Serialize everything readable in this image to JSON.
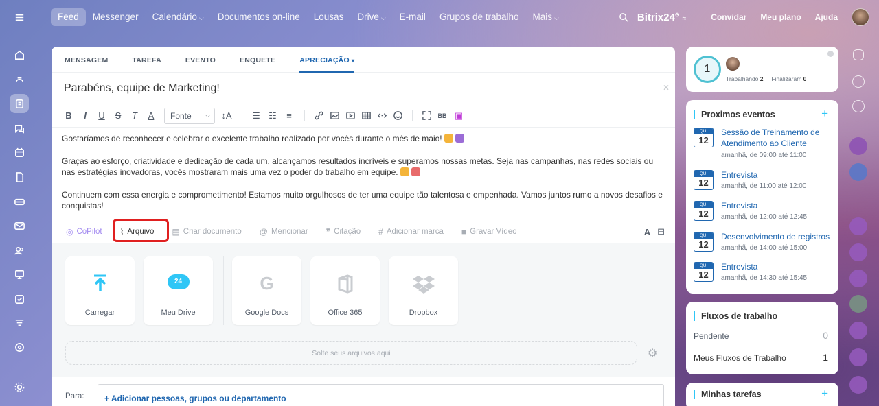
{
  "topnav": {
    "items": [
      "Feed",
      "Messenger",
      "Calendário",
      "Documentos on-line",
      "Lousas",
      "Drive",
      "E-mail",
      "Grupos de trabalho",
      "Mais"
    ],
    "logo": "Bitrix24",
    "invite": "Convidar",
    "plan": "Meu plano",
    "help": "Ajuda"
  },
  "composer": {
    "tabs": [
      "MENSAGEM",
      "TAREFA",
      "EVENTO",
      "ENQUETE",
      "APRECIAÇÃO"
    ],
    "title": "Parabéns, equipe de Marketing!",
    "font_label": "Fonte",
    "paragraphs": [
      "Gostaríamos de reconhecer e celebrar o excelente trabalho realizado por vocês durante o mês de maio!",
      "Graças ao esforço, criatividade e dedicação de cada um, alcançamos resultados incríveis e superamos nossas metas. Seja nas campanhas, nas redes sociais ou nas estratégias inovadoras, vocês mostraram mais uma vez o poder do trabalho em equipe.",
      "Continuem com essa energia e comprometimento! Estamos muito orgulhosos de ter uma equipe tão talentosa e empenhada. Vamos juntos rumo a novos desafios e conquistas!"
    ],
    "actions": [
      "CoPilot",
      "Arquivo",
      "Criar documento",
      "Mencionar",
      "Citação",
      "Adicionar marca",
      "Gravar Vídeo"
    ],
    "upload_tiles": [
      "Carregar",
      "Meu Drive",
      "Google Docs",
      "Office 365",
      "Dropbox"
    ],
    "drive_badge": "24",
    "dropzone": "Solte seus arquivos aqui",
    "to_label": "Para:",
    "to_add": "+ Adicionar pessoas, grupos ou departamento"
  },
  "worktime": {
    "count": "1",
    "working_label": "Trabalhando",
    "working_count": "2",
    "finished_label": "Finalizaram",
    "finished_count": "0"
  },
  "events": {
    "title": "Proximos eventos",
    "day_label": "QUI",
    "items": [
      {
        "day": "12",
        "name": "Sessão de Treinamento de Atendimento ao Cliente",
        "time": "amanhã, de 09:00 até 11:00"
      },
      {
        "day": "12",
        "name": "Entrevista",
        "time": "amanhã, de 11:00 até 12:00"
      },
      {
        "day": "12",
        "name": "Entrevista",
        "time": "amanhã, de 12:00 até 12:45"
      },
      {
        "day": "12",
        "name": "Desenvolvimento de registros",
        "time": "amanhã, de 14:00 até 15:00"
      },
      {
        "day": "12",
        "name": "Entrevista",
        "time": "amanhã, de 14:30 até 15:45"
      }
    ]
  },
  "workflows": {
    "title": "Fluxos de trabalho",
    "pending_label": "Pendente",
    "pending_count": "0",
    "mine_label": "Meus Fluxos de Trabalho",
    "mine_count": "1"
  },
  "tasks": {
    "title": "Minhas tarefas"
  },
  "colors": {
    "accent": "#2067b0",
    "highlight": "#e02020",
    "cyan": "#2fc6f6"
  }
}
